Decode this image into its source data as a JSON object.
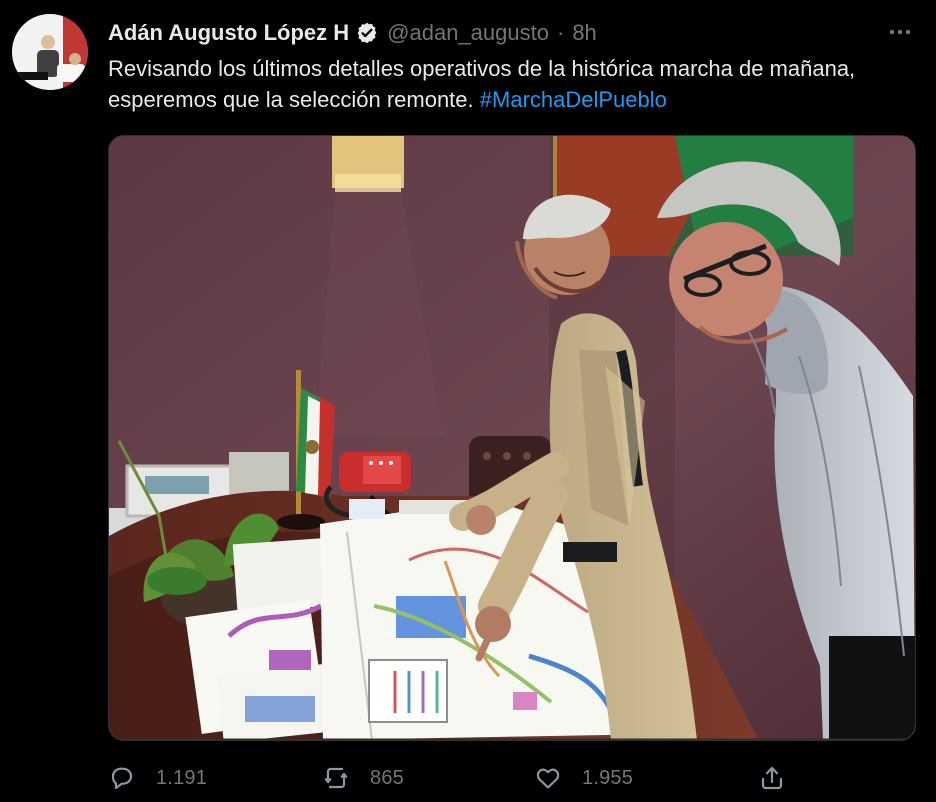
{
  "tweet": {
    "author_name": "Adán Augusto López H",
    "handle": "@adan_augusto",
    "separator": "·",
    "time": "8h",
    "text": "Revisando los últimos detalles operativos de la histórica marcha de mañana, esperemos que la selección remonte. ",
    "hashtag": "#MarchaDelPueblo"
  },
  "actions": {
    "replies": "1.191",
    "retweets": "865",
    "likes": "1.955"
  },
  "colors": {
    "background": "#000000",
    "text": "#e7e9ea",
    "secondary_text": "#71767b",
    "link": "#1d9bf0"
  },
  "icons": {
    "verified": "verified-badge-icon",
    "more": "more-horizontal-icon",
    "reply": "reply-icon",
    "retweet": "retweet-icon",
    "like": "heart-icon",
    "share": "share-icon"
  }
}
